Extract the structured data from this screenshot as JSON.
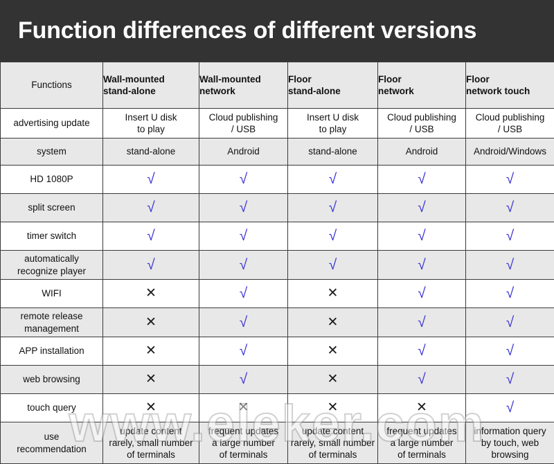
{
  "title": "Function differences of different versions",
  "watermark": "www.eleker.com",
  "colors": {
    "title_bar_bg": "#333333",
    "title_text": "#ffffff",
    "header_bg": "#e8e8e8",
    "shade_row_bg": "#e8e8e8",
    "plain_row_bg": "#ffffff",
    "border": "#3a3a3a",
    "tick": "#3b34d6",
    "cross": "#1a1a1a"
  },
  "table": {
    "headers": [
      "Functions",
      "Wall-mounted stand-alone",
      "Wall-mounted network",
      "Floor stand-alone",
      "Floor network",
      "Floor network touch"
    ],
    "headers_lines": [
      [
        "Functions"
      ],
      [
        "Wall-mounted",
        "stand-alone"
      ],
      [
        "Wall-mounted",
        "network"
      ],
      [
        "Floor",
        "stand-alone"
      ],
      [
        "Floor",
        "network"
      ],
      [
        "Floor",
        "network touch"
      ]
    ],
    "rows": [
      {
        "label": "advertising update",
        "type": "text",
        "cells": [
          "Insert U disk to play",
          "Cloud publishing / USB",
          "Insert U disk to play",
          "Cloud publishing / USB",
          "Cloud publishing / USB"
        ],
        "cells_lines": [
          [
            "Insert U disk",
            "to play"
          ],
          [
            "Cloud publishing",
            "/ USB"
          ],
          [
            "Insert U disk",
            "to play"
          ],
          [
            "Cloud publishing",
            "/ USB"
          ],
          [
            "Cloud publishing",
            "/ USB"
          ]
        ]
      },
      {
        "label": "system",
        "type": "text",
        "cells": [
          "stand-alone",
          "Android",
          "stand-alone",
          "Android",
          "Android/Windows"
        ],
        "cells_lines": [
          [
            "stand-alone"
          ],
          [
            "Android"
          ],
          [
            "stand-alone"
          ],
          [
            "Android"
          ],
          [
            "Android/Windows"
          ]
        ]
      },
      {
        "label": "HD 1080P",
        "type": "mark",
        "cells": [
          "check",
          "check",
          "check",
          "check",
          "check"
        ]
      },
      {
        "label": "split screen",
        "type": "mark",
        "cells": [
          "check",
          "check",
          "check",
          "check",
          "check"
        ]
      },
      {
        "label": "timer switch",
        "type": "mark",
        "cells": [
          "check",
          "check",
          "check",
          "check",
          "check"
        ]
      },
      {
        "label": "automatically recognize player",
        "label_lines": [
          "automatically",
          "recognize player"
        ],
        "type": "mark",
        "cells": [
          "check",
          "check",
          "check",
          "check",
          "check"
        ]
      },
      {
        "label": "WIFI",
        "type": "mark",
        "cells": [
          "cross",
          "check",
          "cross",
          "check",
          "check"
        ]
      },
      {
        "label": "remote release management",
        "label_lines": [
          "remote release",
          "management"
        ],
        "type": "mark",
        "cells": [
          "cross",
          "check",
          "cross",
          "check",
          "check"
        ]
      },
      {
        "label": "APP installation",
        "type": "mark",
        "cells": [
          "cross",
          "check",
          "cross",
          "check",
          "check"
        ]
      },
      {
        "label": "web browsing",
        "type": "mark",
        "cells": [
          "cross",
          "check",
          "cross",
          "check",
          "check"
        ]
      },
      {
        "label": "touch query",
        "type": "mark",
        "cells": [
          "cross",
          "cross",
          "cross",
          "cross",
          "check"
        ]
      },
      {
        "label": "use recommendation",
        "label_lines": [
          "use",
          "recommendation"
        ],
        "type": "text",
        "cells": [
          "update content rarely, small number of terminals",
          "frequent updates a large number of terminals",
          "update content rarely, small number of terminals",
          "frequent updates a large number of terminals",
          "information query by touch, web browsing"
        ],
        "cells_lines": [
          [
            "update content",
            "rarely, small number",
            "of terminals"
          ],
          [
            "frequent updates",
            "a large number",
            "of terminals"
          ],
          [
            "update content",
            "rarely, small number",
            "of terminals"
          ],
          [
            "frequent updates",
            "a large number",
            "of terminals"
          ],
          [
            "information query",
            "by touch, web",
            "browsing"
          ]
        ]
      }
    ]
  },
  "glyphs": {
    "check": "√",
    "cross": "✕"
  }
}
